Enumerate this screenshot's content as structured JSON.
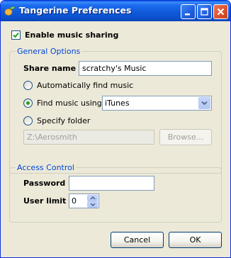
{
  "window": {
    "title": "Tangerine Preferences",
    "app_icon": "tangerine-icon"
  },
  "sharing": {
    "label": "Enable music sharing",
    "checked": true
  },
  "general": {
    "legend": "General Options",
    "share_name_label": "Share name",
    "share_name_value": "scratchy's Music",
    "auto_find_label": "Automatically find music",
    "find_using_label": "Find music using:",
    "find_using_value": "iTunes",
    "specify_folder_label": "Specify folder",
    "folder_path": "Z:\\Aerosmith",
    "browse_label": "Browse...",
    "selected_option": "find_using"
  },
  "access": {
    "legend": "Access Control",
    "password_label": "Password",
    "password_value": "",
    "user_limit_label": "User limit",
    "user_limit_value": "0"
  },
  "buttons": {
    "cancel": "Cancel",
    "ok": "OK"
  },
  "colors": {
    "titlebar": "#0a5ee8",
    "window_bg": "#ece9d8",
    "group_legend": "#0046d5",
    "radio_dot": "#21a121",
    "check_mark": "#21a121"
  }
}
